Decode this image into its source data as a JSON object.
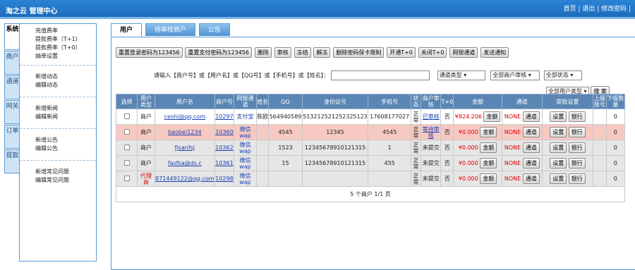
{
  "header": {
    "logo": "淘之云 管理中心",
    "links": "首页 | 退出 | 修改密码 |"
  },
  "sidebar": {
    "tabs": [
      "系统",
      "商户",
      "通道",
      "网关",
      "订单",
      "提款"
    ],
    "groups": [
      [
        "充值费率",
        "提款费率（T+1）",
        "提款费率（T+0）",
        "抽单设置"
      ],
      [
        "新增动态",
        "编辑动态"
      ],
      [
        "新增新闻",
        "编辑新闻"
      ],
      [
        "新增公告",
        "编辑公告"
      ],
      [
        "新增常见问题",
        "编辑常见问题"
      ]
    ]
  },
  "tabs": [
    "用户",
    "待审核商户",
    "公告"
  ],
  "actions": [
    "重置登录密码为123456",
    "重置支付密码为123456",
    "删除",
    "审核",
    "冻结",
    "解冻",
    "删除密码保卡限制",
    "开通T+0",
    "关闭T+0",
    "网银通道",
    "发送通知"
  ],
  "search": {
    "label": "请输入【商户号】或【用户名】或【QQ号】或【手机号】或【姓名】：",
    "channel": "通道类型",
    "audit": "全部商户审核",
    "status": "全部状态",
    "usertype": "全部用户类型",
    "search_btn": "搜 索"
  },
  "table": {
    "headers": [
      "选择",
      "用户类型",
      "用户名",
      "商户号",
      "网银通道",
      "姓名",
      "QQ",
      "身份证号",
      "手机号",
      "状态",
      "商户审核",
      "T+0",
      "金额",
      "通道",
      "提款设置",
      "上级账号",
      "下级数量"
    ],
    "rows": [
      {
        "style": "white",
        "type": "商户",
        "username": "ceshi@qq.com",
        "mid": "10297",
        "bank": "支付宝",
        "name": "陈欧",
        "qq": "564940589",
        "idcard": "513212521252325123",
        "phone": "17608177027",
        "state": "正常",
        "audit": "已审核",
        "t0": "否",
        "amount": "¥824.206",
        "amt_btn": "金额",
        "channel": "NONE",
        "ch_btn": "通道",
        "set_btn": "设置",
        "bank_btn": "银行",
        "parent": "",
        "sub": "0"
      },
      {
        "style": "pink",
        "type": "商户",
        "username": "baobei1234",
        "mid": "10360",
        "bank": "微信wap",
        "name": "",
        "qq": "4545",
        "idcard": "12345",
        "phone": "4545",
        "state": "正常",
        "audit": "等待审核",
        "t0": "否",
        "amount": "¥0.000",
        "amt_btn": "金额",
        "channel": "NONE",
        "ch_btn": "通道",
        "set_btn": "设置",
        "bank_btn": "银行",
        "parent": "",
        "sub": "0"
      },
      {
        "style": "grey",
        "type": "商户",
        "username": "fjsanfsj",
        "mid": "10362",
        "bank": "微信wap",
        "name": "",
        "qq": "1523",
        "idcard": "12345678910121315",
        "phone": "1",
        "state": "正常",
        "audit": "未提交",
        "t0": "否",
        "amount": "¥0.000",
        "amt_btn": "金额",
        "channel": "NONE",
        "ch_btn": "通道",
        "set_btn": "设置",
        "bank_btn": "银行",
        "parent": "",
        "sub": "0"
      },
      {
        "style": "grey",
        "type": "商户",
        "username": "fasfsa@ds.c",
        "mid": "10361",
        "bank": "微信wap",
        "name": "",
        "qq": "15",
        "idcard": "12345678910121315",
        "phone": "455",
        "state": "正常",
        "audit": "未提交",
        "t0": "否",
        "amount": "¥0.000",
        "amt_btn": "金额",
        "channel": "NONE",
        "ch_btn": "通道",
        "set_btn": "设置",
        "bank_btn": "银行",
        "parent": "",
        "sub": "0"
      },
      {
        "style": "grey",
        "type": "代理商",
        "username": "871449122@qq.com",
        "mid": "10298",
        "bank": "微信wap",
        "name": "",
        "qq": "",
        "idcard": "",
        "phone": "",
        "state": "正常",
        "audit": "未提交",
        "t0": "否",
        "amount": "¥0.000",
        "amt_btn": "金额",
        "channel": "NONE",
        "ch_btn": "通道",
        "set_btn": "设置",
        "bank_btn": "银行",
        "parent": "",
        "sub": "0"
      }
    ],
    "footer": "5 个商户 1/1 页"
  }
}
